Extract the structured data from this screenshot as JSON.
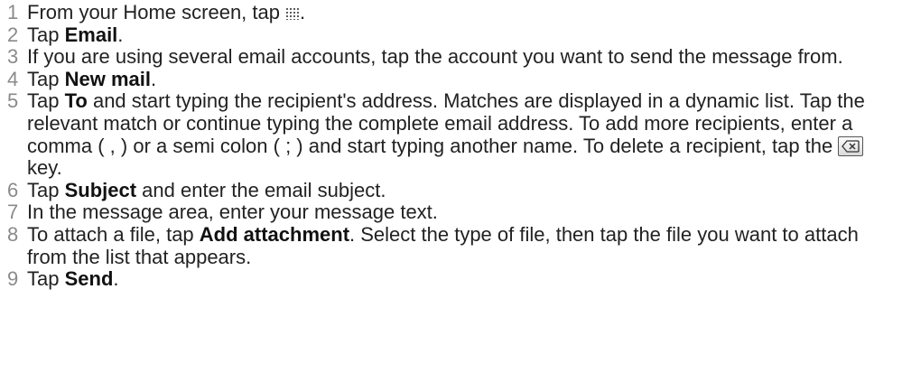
{
  "steps": [
    {
      "num": "1",
      "parts": [
        "From your Home screen, tap",
        "."
      ]
    },
    {
      "num": "2",
      "parts": [
        "Tap ",
        "Email",
        "."
      ]
    },
    {
      "num": "3",
      "parts": [
        "If you are using several email accounts, tap the account you want to send the message from."
      ]
    },
    {
      "num": "4",
      "parts": [
        "Tap ",
        "New mail",
        "."
      ]
    },
    {
      "num": "5",
      "parts": [
        "Tap ",
        "To",
        " and start typing the recipient's address. Matches are displayed in a dynamic list. Tap the relevant match or continue typing the complete email address. To add more recipients, enter a comma ( , ) or a semi colon ( ; ) and start typing another name. To delete a recipient, tap the",
        "key."
      ]
    },
    {
      "num": "6",
      "parts": [
        "Tap ",
        "Subject",
        " and enter the email subject."
      ]
    },
    {
      "num": "7",
      "parts": [
        "In the message area, enter your message text."
      ]
    },
    {
      "num": "8",
      "parts": [
        "To attach a file, tap ",
        "Add attachment",
        ". Select the type of file, then tap the file you want to attach from the list that appears."
      ]
    },
    {
      "num": "9",
      "parts": [
        "Tap ",
        "Send",
        "."
      ]
    }
  ],
  "icons": {
    "apps": "app-grid-icon",
    "delete": "backspace-key-icon"
  }
}
